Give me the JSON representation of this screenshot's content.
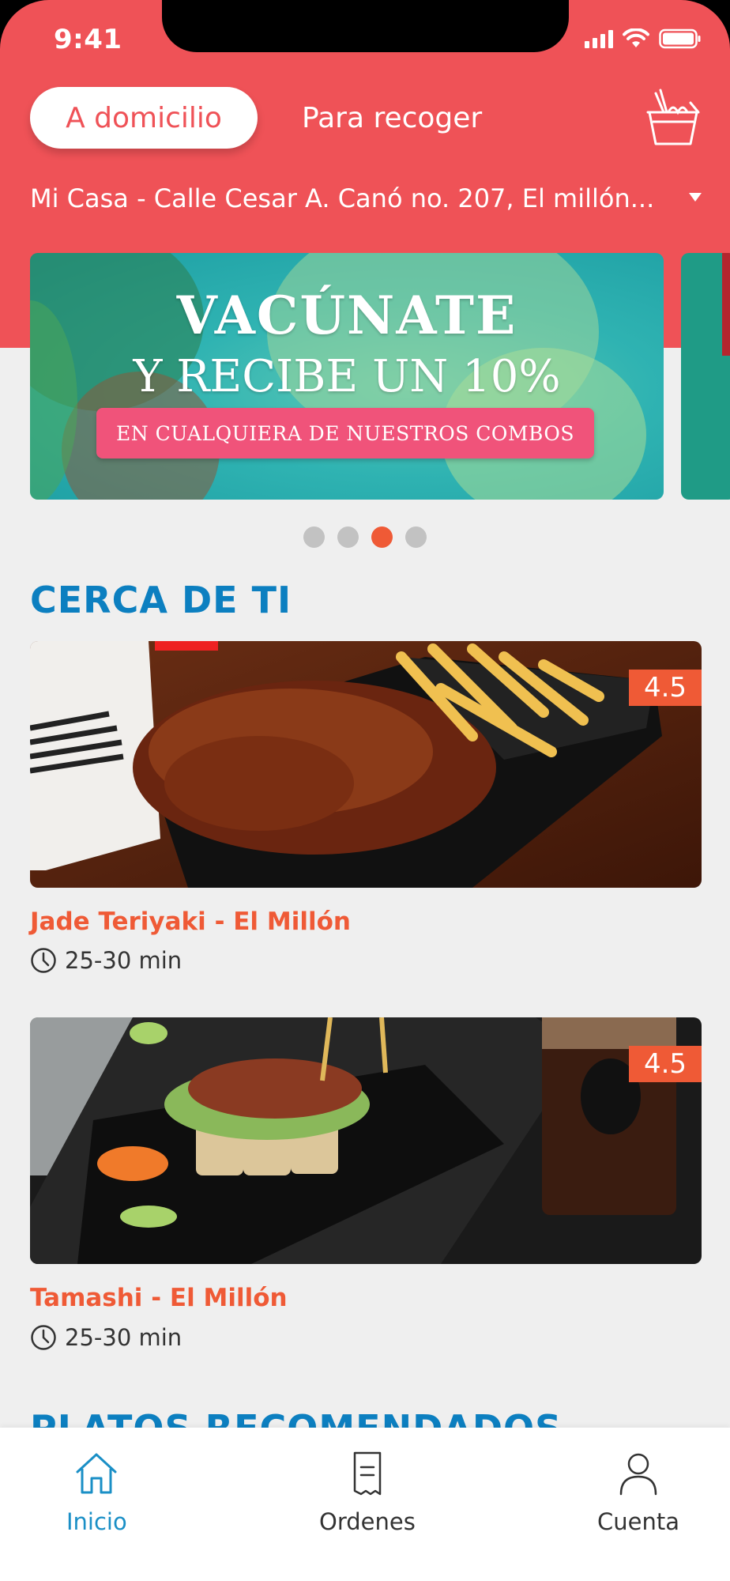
{
  "status_bar": {
    "time": "9:41"
  },
  "header": {
    "delivery_mode_active": "A domicilio",
    "delivery_mode_other": "Para recoger",
    "address": "Mi Casa - Calle Cesar A. Canó no. 207, El millón...",
    "cart_icon": "takeout-box-icon"
  },
  "banner": {
    "line1": "VACÚNATE",
    "line2": "Y RECIBE UN 10%",
    "pill": "EN CUALQUIERA DE NUESTROS COMBOS",
    "page_count": 4,
    "active_page_index": 2
  },
  "section_nearby": {
    "title": "CERCA DE TI"
  },
  "restaurants": [
    {
      "name": "Jade Teriyaki - El Millón",
      "time": "25-30 min",
      "rating": "4.5"
    },
    {
      "name": "Tamashi - El Millón",
      "time": "25-30 min",
      "rating": "4.5"
    }
  ],
  "section_recommended": {
    "title": "PLATOS RECOMENDADOS"
  },
  "tabbar": {
    "items": [
      {
        "label": "Inicio",
        "icon": "home-icon",
        "active": true
      },
      {
        "label": "Ordenes",
        "icon": "receipt-icon",
        "active": false
      },
      {
        "label": "Cuenta",
        "icon": "user-icon",
        "active": false
      }
    ]
  },
  "colors": {
    "brand_red": "#ef5257",
    "accent_orange": "#ef5a36",
    "title_blue": "#0c7fc0",
    "active_tab": "#1a8fc6"
  }
}
